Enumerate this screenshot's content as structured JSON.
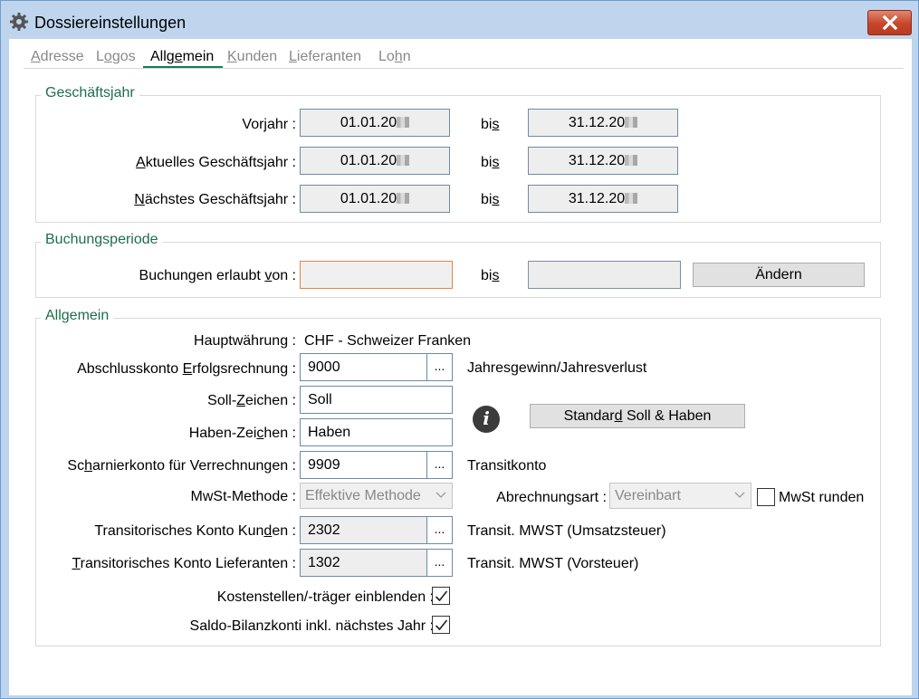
{
  "window": {
    "title": "Dossiereinstellungen"
  },
  "tabs": [
    {
      "pre": "",
      "ul": "A",
      "post": "dresse"
    },
    {
      "pre": "L",
      "ul": "o",
      "post": "gos"
    },
    {
      "pre": "Allg",
      "ul": "e",
      "post": "mein"
    },
    {
      "pre": "",
      "ul": "K",
      "post": "unden"
    },
    {
      "pre": "",
      "ul": "L",
      "post": "ieferanten"
    },
    {
      "pre": "Lo",
      "ul": "h",
      "post": "n"
    }
  ],
  "fiscal": {
    "title": "Geschäftsjahr",
    "bis_pre": "bi",
    "bis_ul": "s",
    "bis_post": "",
    "rows": [
      {
        "label_pre": "Vorjahr :",
        "label_ul": "",
        "label_post": "",
        "from": "01.01.20",
        "to": "31.12.20"
      },
      {
        "label_pre": "",
        "label_ul": "A",
        "label_post": "ktuelles Geschäftsjahr :",
        "from": "01.01.20",
        "to": "31.12.20"
      },
      {
        "label_pre": "",
        "label_ul": "N",
        "label_post": "ächstes Geschäftsjahr :",
        "from": "01.01.20",
        "to": "31.12.20"
      }
    ]
  },
  "posting": {
    "title": "Buchungsperiode",
    "label_pre": "Buchungen erlaubt ",
    "label_ul": "v",
    "label_post": "on :",
    "from": "",
    "to": "",
    "bis_pre": "bi",
    "bis_ul": "s",
    "bis_post": "",
    "change_button": "Ändern"
  },
  "general": {
    "title": "Allgemein",
    "currency_label": "Hauptwährung :",
    "currency_value": "CHF - Schweizer Franken",
    "closing_label_pre": "Abschlusskonto ",
    "closing_label_ul": "E",
    "closing_label_post": "rfolgsrechnung :",
    "closing_value": "9000",
    "closing_desc": "Jahresgewinn/Jahresverlust",
    "debit_label_pre": "Soll-",
    "debit_label_ul": "Z",
    "debit_label_post": "eichen :",
    "debit_value": "Soll",
    "credit_label_pre": "Haben-Zei",
    "credit_label_ul": "c",
    "credit_label_post": "hen :",
    "credit_value": "Haben",
    "standard_button_pre": "Standar",
    "standard_button_ul": "d",
    "standard_button_post": " Soll & Haben",
    "hinge_label_pre": "Sc",
    "hinge_label_ul": "h",
    "hinge_label_post": "arnierkonto für Verrechnungen :",
    "hinge_value": "9909",
    "hinge_desc": "Transitkonto",
    "vat_method_label": "MwSt-Methode :",
    "vat_method_value": "Effektive Methode",
    "billing_label": "Abrechnungsart :",
    "billing_value": "Vereinbart",
    "vat_round_label": "MwSt runden",
    "vat_round_checked": false,
    "transit_cust_label_pre": "Transitorisches Konto Kun",
    "transit_cust_label_ul": "d",
    "transit_cust_label_post": "en :",
    "transit_cust_value": "2302",
    "transit_cust_desc": "Transit. MWST (Umsatzsteuer)",
    "transit_supp_label_pre": "",
    "transit_supp_label_ul": "T",
    "transit_supp_label_post": "ransitorisches Konto Lieferanten :",
    "transit_supp_value": "1302",
    "transit_supp_desc": "Transit. MWST (Vorsteuer)",
    "cost_center_label": "Kostenstellen/-träger einblenden :",
    "cost_center_checked": true,
    "balance_label": "Saldo-Bilanzkonti inkl. nächstes Jahr :",
    "balance_checked": true,
    "dots": "..."
  }
}
